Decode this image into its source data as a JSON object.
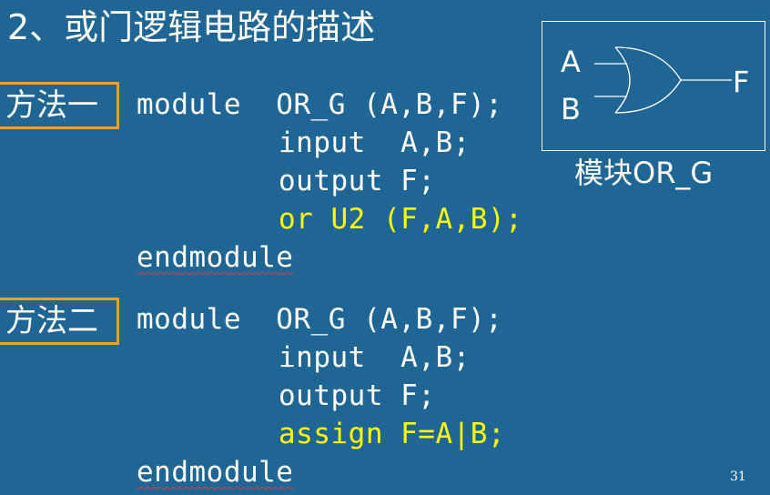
{
  "title": "2、或门逻辑电路的描述",
  "methods": [
    {
      "label": "方法一",
      "lines": [
        "module  OR_G (A,B,F);",
        "input  A,B;",
        "output F;",
        "or U2 (F,A,B);",
        "endmodule"
      ]
    },
    {
      "label": "方法二",
      "lines": [
        "module  OR_G (A,B,F);",
        "input  A,B;",
        "output F;",
        "assign F=A|B;",
        "endmodule"
      ]
    }
  ],
  "diagram": {
    "input_a": "A",
    "input_b": "B",
    "output_f": "F",
    "caption": "模块OR_G"
  },
  "page_number": "31",
  "colors": {
    "background": "#1f6695",
    "text": "#ffffff",
    "highlight": "#ffff00",
    "label_border": "#f0a020"
  }
}
